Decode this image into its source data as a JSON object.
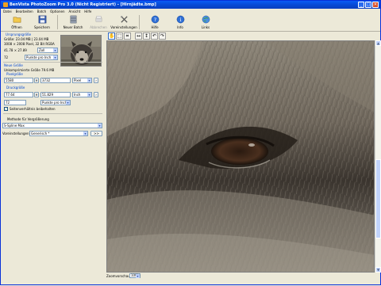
{
  "window": {
    "title": "BenVista PhotoZoom Pro 3.0 (Nicht Registriert) - [Hirnjädte.bmp]",
    "controls": [
      "_",
      "□",
      "✕"
    ]
  },
  "menu": [
    "Datei",
    "Bearbeiten",
    "Batch",
    "Optionen",
    "Ansicht",
    "Hilfe"
  ],
  "toolbar": {
    "open": "Öffnen",
    "save": "Speichern",
    "new_batch": "Neuer Batch",
    "disabled_tool": "Abbrechen",
    "presets": "Voreinstellungen",
    "help": "Hilfe",
    "info": "Info",
    "links": "Links"
  },
  "original_size": {
    "heading": "Ursprungsgröße",
    "file_size": "Größe: 23.04 MB | 23.04 MB",
    "pixels": "3008 × 2008 Pixel, 32 Bit RGBA",
    "print_size_value": "41.78 × 27.89",
    "print_unit": "Zoll",
    "resolution_value": "72",
    "resolution_unit": "Punkte pro Inch"
  },
  "new_size": {
    "heading": "Neue Größe",
    "uncompressed": "Unkomprimierte Größe 79.6 MB",
    "pixel_heading": "Pixelgröße",
    "width_px": "5580",
    "height_px": "3732",
    "pixel_unit": "Pixel",
    "print_heading": "Druckgröße",
    "width_print": "77.64",
    "height_print": "51.829",
    "print_unit": "Inch",
    "resolution_value": "72",
    "resolution_unit": "Punkte pro Inch",
    "keep_ratio_label": "Seitenverhältnis beibehalten",
    "keep_ratio_checked": true
  },
  "method": {
    "heading": "Methode für Vergrößerung",
    "value": "S-Spline Max",
    "presets_label": "Voreinstellungen:",
    "presets_value": "Generisch *",
    "more_button": ">>"
  },
  "canvas_tools": [
    "hand-icon",
    "select-icon",
    "crop-icon",
    "fit-width-icon",
    "fit-height-icon",
    "rotate-left-icon",
    "rotate-right-icon"
  ],
  "status": {
    "zoom_label": "Zoomvorschau:",
    "zoom_value": "100%"
  }
}
